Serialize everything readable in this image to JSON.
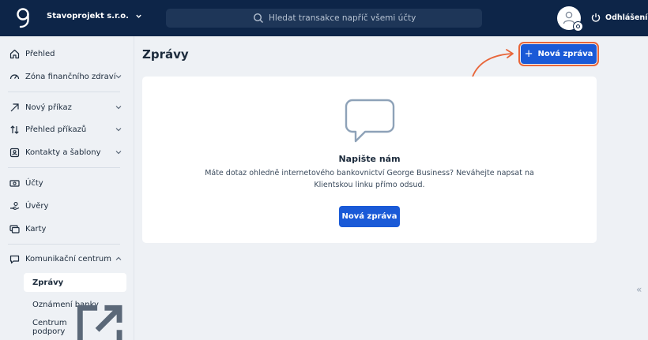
{
  "header": {
    "company": "Stavoprojekt s.r.o.",
    "search_placeholder": "Hledat transakce napříč všemi účty",
    "logout_label": "Odhlášení"
  },
  "sidebar": {
    "items": [
      {
        "label": "Přehled",
        "icon": "home-icon"
      },
      {
        "label": "Zóna finančního zdraví",
        "icon": "gauge-icon"
      },
      {
        "label": "Nový příkaz",
        "icon": "arrow-up-right-icon"
      },
      {
        "label": "Přehled příkazů",
        "icon": "swap-arrows-icon"
      },
      {
        "label": "Kontakty a šablony",
        "icon": "contact-card-icon"
      },
      {
        "label": "Účty",
        "icon": "banknote-icon"
      },
      {
        "label": "Úvěry",
        "icon": "hand-coin-icon"
      },
      {
        "label": "Karty",
        "icon": "cards-icon"
      },
      {
        "label": "Komunikační centrum",
        "icon": "chat-icon"
      }
    ],
    "sub_items": [
      {
        "label": "Zprávy",
        "active": true
      },
      {
        "label": "Oznámení banky",
        "active": false
      },
      {
        "label": "Centrum podpory",
        "active": false
      }
    ]
  },
  "main": {
    "title": "Zprávy",
    "new_message_label": "Nová zpráva",
    "card": {
      "title": "Napište nám",
      "text": "Máte dotaz ohledně internetového bankovnictví George Business? Neváhejte napsat na Klientskou linku přímo odsud.",
      "button_label": "Nová zpráva"
    },
    "collapse_glyph": "«"
  },
  "colors": {
    "header_bg": "#0d2548",
    "primary": "#1a5ad7",
    "highlight": "#e8663a"
  }
}
